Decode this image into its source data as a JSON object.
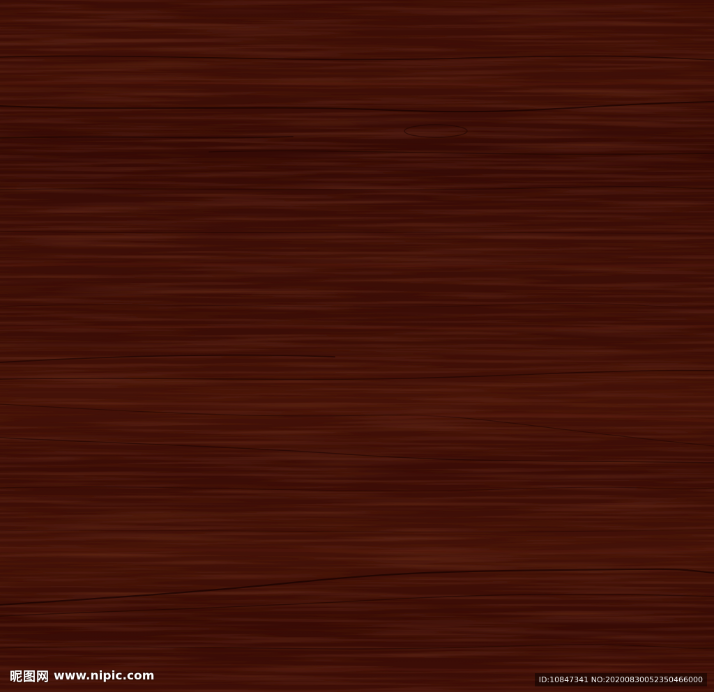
{
  "image": {
    "subject": "wood-grain-texture",
    "base_color": "#3a0c06",
    "light_color": "#56180d",
    "dark_color": "#1c0402"
  },
  "watermark": {
    "brand": "昵图网",
    "url": "www.nipic.com",
    "id_text": "ID:10847341 NO:20200830052350466000"
  }
}
